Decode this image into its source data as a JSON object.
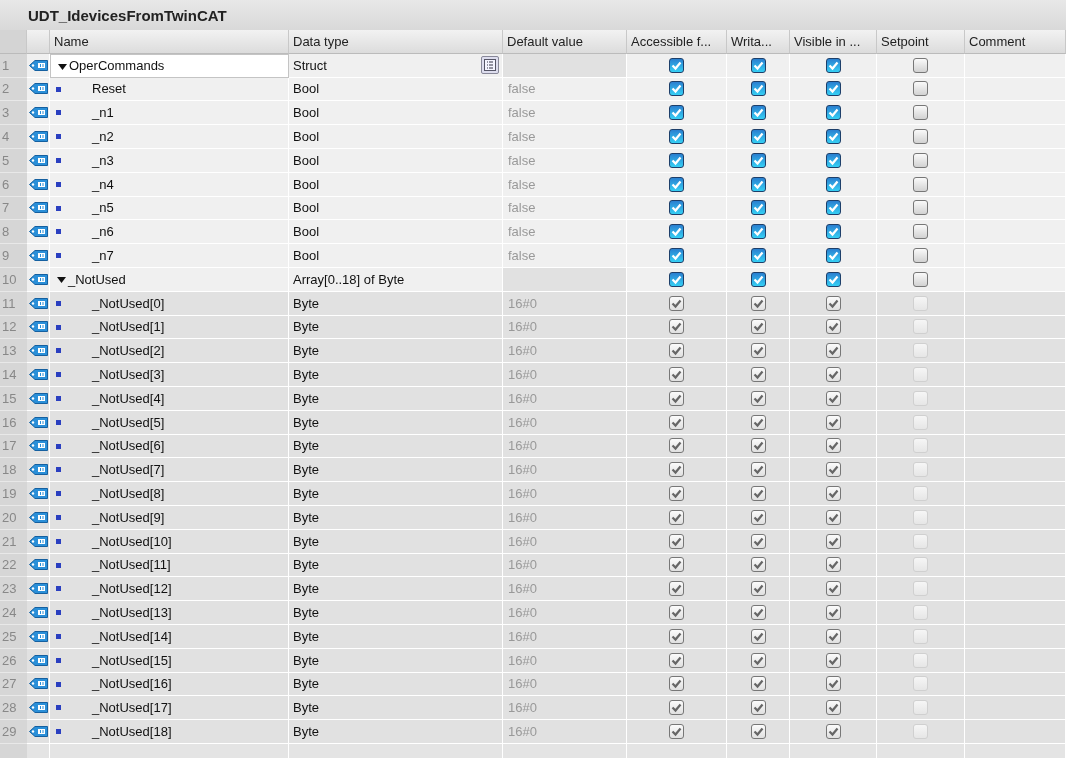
{
  "title": "UDT_IdevicesFromTwinCAT",
  "columns": [
    "Name",
    "Data type",
    "Default value",
    "Accessible f...",
    "Writa...",
    "Visible in ...",
    "Setpoint",
    "Comment"
  ],
  "rows": [
    {
      "number": "1",
      "name": "OperCommands",
      "data_type": "Struct",
      "default_value": "",
      "selected": true,
      "expanded": true,
      "disabled": false,
      "accessible": true,
      "writable": true,
      "visible": true,
      "setpoint": false,
      "children": [
        {
          "number": "2",
          "name": "Reset",
          "data_type": "Bool",
          "default_value": "false",
          "selected": false,
          "disabled": false,
          "accessible": true,
          "writable": true,
          "visible": true,
          "setpoint": false
        },
        {
          "number": "3",
          "name": "_n1",
          "data_type": "Bool",
          "default_value": "false",
          "selected": false,
          "disabled": false,
          "accessible": true,
          "writable": true,
          "visible": true,
          "setpoint": false
        },
        {
          "number": "4",
          "name": "_n2",
          "data_type": "Bool",
          "default_value": "false",
          "selected": false,
          "disabled": false,
          "accessible": true,
          "writable": true,
          "visible": true,
          "setpoint": false
        },
        {
          "number": "5",
          "name": "_n3",
          "data_type": "Bool",
          "default_value": "false",
          "selected": false,
          "disabled": false,
          "accessible": true,
          "writable": true,
          "visible": true,
          "setpoint": false
        },
        {
          "number": "6",
          "name": "_n4",
          "data_type": "Bool",
          "default_value": "false",
          "selected": false,
          "disabled": false,
          "accessible": true,
          "writable": true,
          "visible": true,
          "setpoint": false
        },
        {
          "number": "7",
          "name": "_n5",
          "data_type": "Bool",
          "default_value": "false",
          "selected": false,
          "disabled": false,
          "accessible": true,
          "writable": true,
          "visible": true,
          "setpoint": false
        },
        {
          "number": "8",
          "name": "_n6",
          "data_type": "Bool",
          "default_value": "false",
          "selected": false,
          "disabled": false,
          "accessible": true,
          "writable": true,
          "visible": true,
          "setpoint": false
        },
        {
          "number": "9",
          "name": "_n7",
          "data_type": "Bool",
          "default_value": "false",
          "selected": false,
          "disabled": false,
          "accessible": true,
          "writable": true,
          "visible": true,
          "setpoint": false
        }
      ]
    },
    {
      "number": "10",
      "name": "_NotUsed",
      "data_type": "Array[0..18] of Byte",
      "default_value": "",
      "selected": false,
      "expanded": true,
      "disabled": false,
      "accessible": true,
      "writable": true,
      "visible": true,
      "setpoint": false,
      "children": [
        {
          "number": "11",
          "name": "_NotUsed[0]",
          "data_type": "Byte",
          "default_value": "16#0",
          "selected": false,
          "disabled": true,
          "accessible": true,
          "writable": true,
          "visible": true,
          "setpoint": false
        },
        {
          "number": "12",
          "name": "_NotUsed[1]",
          "data_type": "Byte",
          "default_value": "16#0",
          "selected": false,
          "disabled": true,
          "accessible": true,
          "writable": true,
          "visible": true,
          "setpoint": false
        },
        {
          "number": "13",
          "name": "_NotUsed[2]",
          "data_type": "Byte",
          "default_value": "16#0",
          "selected": false,
          "disabled": true,
          "accessible": true,
          "writable": true,
          "visible": true,
          "setpoint": false
        },
        {
          "number": "14",
          "name": "_NotUsed[3]",
          "data_type": "Byte",
          "default_value": "16#0",
          "selected": false,
          "disabled": true,
          "accessible": true,
          "writable": true,
          "visible": true,
          "setpoint": false
        },
        {
          "number": "15",
          "name": "_NotUsed[4]",
          "data_type": "Byte",
          "default_value": "16#0",
          "selected": false,
          "disabled": true,
          "accessible": true,
          "writable": true,
          "visible": true,
          "setpoint": false
        },
        {
          "number": "16",
          "name": "_NotUsed[5]",
          "data_type": "Byte",
          "default_value": "16#0",
          "selected": false,
          "disabled": true,
          "accessible": true,
          "writable": true,
          "visible": true,
          "setpoint": false
        },
        {
          "number": "17",
          "name": "_NotUsed[6]",
          "data_type": "Byte",
          "default_value": "16#0",
          "selected": false,
          "disabled": true,
          "accessible": true,
          "writable": true,
          "visible": true,
          "setpoint": false
        },
        {
          "number": "18",
          "name": "_NotUsed[7]",
          "data_type": "Byte",
          "default_value": "16#0",
          "selected": false,
          "disabled": true,
          "accessible": true,
          "writable": true,
          "visible": true,
          "setpoint": false
        },
        {
          "number": "19",
          "name": "_NotUsed[8]",
          "data_type": "Byte",
          "default_value": "16#0",
          "selected": false,
          "disabled": true,
          "accessible": true,
          "writable": true,
          "visible": true,
          "setpoint": false
        },
        {
          "number": "20",
          "name": "_NotUsed[9]",
          "data_type": "Byte",
          "default_value": "16#0",
          "selected": false,
          "disabled": true,
          "accessible": true,
          "writable": true,
          "visible": true,
          "setpoint": false
        },
        {
          "number": "21",
          "name": "_NotUsed[10]",
          "data_type": "Byte",
          "default_value": "16#0",
          "selected": false,
          "disabled": true,
          "accessible": true,
          "writable": true,
          "visible": true,
          "setpoint": false
        },
        {
          "number": "22",
          "name": "_NotUsed[11]",
          "data_type": "Byte",
          "default_value": "16#0",
          "selected": false,
          "disabled": true,
          "accessible": true,
          "writable": true,
          "visible": true,
          "setpoint": false
        },
        {
          "number": "23",
          "name": "_NotUsed[12]",
          "data_type": "Byte",
          "default_value": "16#0",
          "selected": false,
          "disabled": true,
          "accessible": true,
          "writable": true,
          "visible": true,
          "setpoint": false
        },
        {
          "number": "24",
          "name": "_NotUsed[13]",
          "data_type": "Byte",
          "default_value": "16#0",
          "selected": false,
          "disabled": true,
          "accessible": true,
          "writable": true,
          "visible": true,
          "setpoint": false
        },
        {
          "number": "25",
          "name": "_NotUsed[14]",
          "data_type": "Byte",
          "default_value": "16#0",
          "selected": false,
          "disabled": true,
          "accessible": true,
          "writable": true,
          "visible": true,
          "setpoint": false
        },
        {
          "number": "26",
          "name": "_NotUsed[15]",
          "data_type": "Byte",
          "default_value": "16#0",
          "selected": false,
          "disabled": true,
          "accessible": true,
          "writable": true,
          "visible": true,
          "setpoint": false
        },
        {
          "number": "27",
          "name": "_NotUsed[16]",
          "data_type": "Byte",
          "default_value": "16#0",
          "selected": false,
          "disabled": true,
          "accessible": true,
          "writable": true,
          "visible": true,
          "setpoint": false
        },
        {
          "number": "28",
          "name": "_NotUsed[17]",
          "data_type": "Byte",
          "default_value": "16#0",
          "selected": false,
          "disabled": true,
          "accessible": true,
          "writable": true,
          "visible": true,
          "setpoint": false
        },
        {
          "number": "29",
          "name": "_NotUsed[18]",
          "data_type": "Byte",
          "default_value": "16#0",
          "selected": false,
          "disabled": true,
          "accessible": true,
          "writable": true,
          "visible": true,
          "setpoint": false
        }
      ]
    }
  ]
}
